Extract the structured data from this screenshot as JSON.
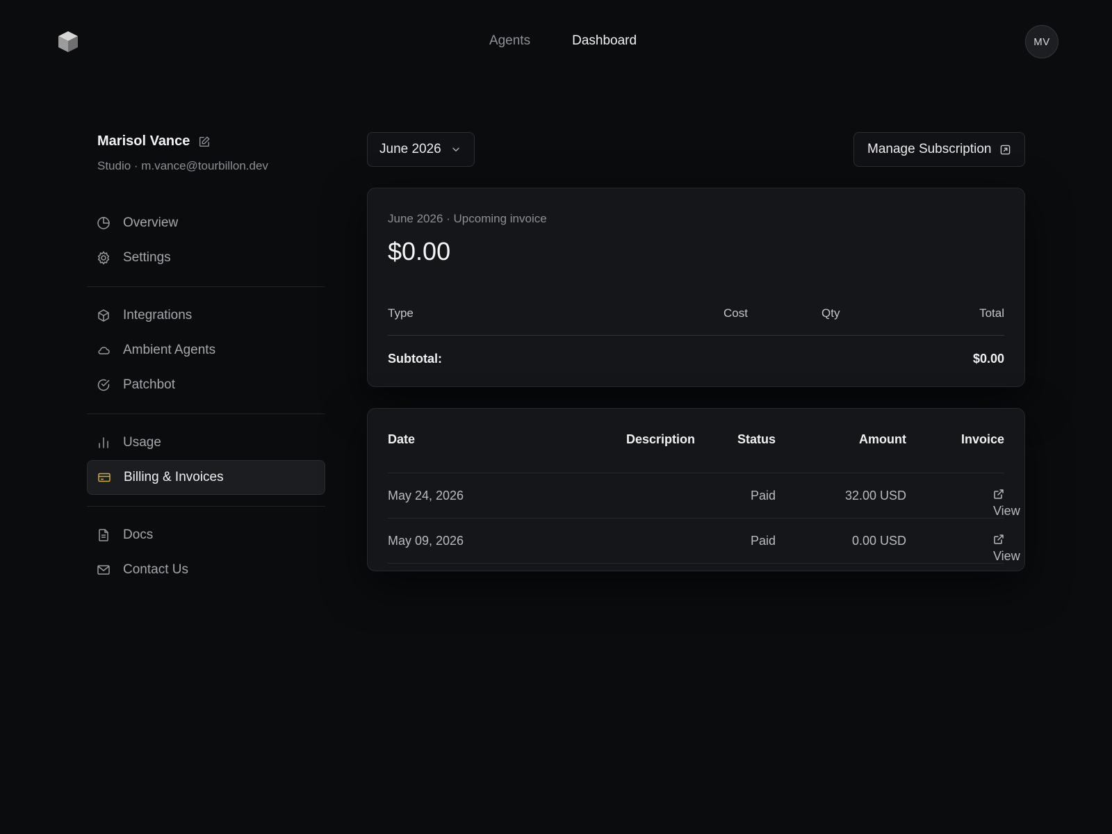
{
  "nav": {
    "tabs": [
      {
        "label": "Agents",
        "active": false
      },
      {
        "label": "Dashboard",
        "active": true
      }
    ],
    "avatar_initials": "MV"
  },
  "profile": {
    "name": "Marisol Vance",
    "subtitle": "Studio · m.vance@tourbillon.dev"
  },
  "sidebar": {
    "items": [
      {
        "label": "Overview",
        "icon": "pie-chart-icon"
      },
      {
        "label": "Settings",
        "icon": "gear-icon"
      },
      {
        "label": "Integrations",
        "icon": "cube-icon"
      },
      {
        "label": "Ambient Agents",
        "icon": "cloud-icon"
      },
      {
        "label": "Patchbot",
        "icon": "check-circle-icon"
      },
      {
        "label": "Usage",
        "icon": "bar-chart-icon"
      },
      {
        "label": "Billing & Invoices",
        "icon": "credit-card-icon",
        "active": true
      },
      {
        "label": "Docs",
        "icon": "document-icon"
      },
      {
        "label": "Contact Us",
        "icon": "mail-icon"
      }
    ]
  },
  "controls": {
    "month": "June 2026",
    "manage_label": "Manage Subscription"
  },
  "upcoming": {
    "label": "June 2026 · Upcoming invoice",
    "amount": "$0.00",
    "columns": {
      "type": "Type",
      "cost": "Cost",
      "qty": "Qty",
      "total": "Total"
    },
    "subtotal_label": "Subtotal:",
    "subtotal_value": "$0.00"
  },
  "history": {
    "columns": {
      "date": "Date",
      "description": "Description",
      "status": "Status",
      "amount": "Amount",
      "invoice": "Invoice"
    },
    "rows": [
      {
        "date": "May 24, 2026",
        "description": "",
        "status": "Paid",
        "amount": "32.00 USD",
        "invoice": "View"
      },
      {
        "date": "May 09, 2026",
        "description": "",
        "status": "Paid",
        "amount": "0.00 USD",
        "invoice": "View"
      }
    ]
  },
  "colors": {
    "background": "#0b0c0e",
    "card": "#151619",
    "accent_billing": "#d9a54a"
  }
}
